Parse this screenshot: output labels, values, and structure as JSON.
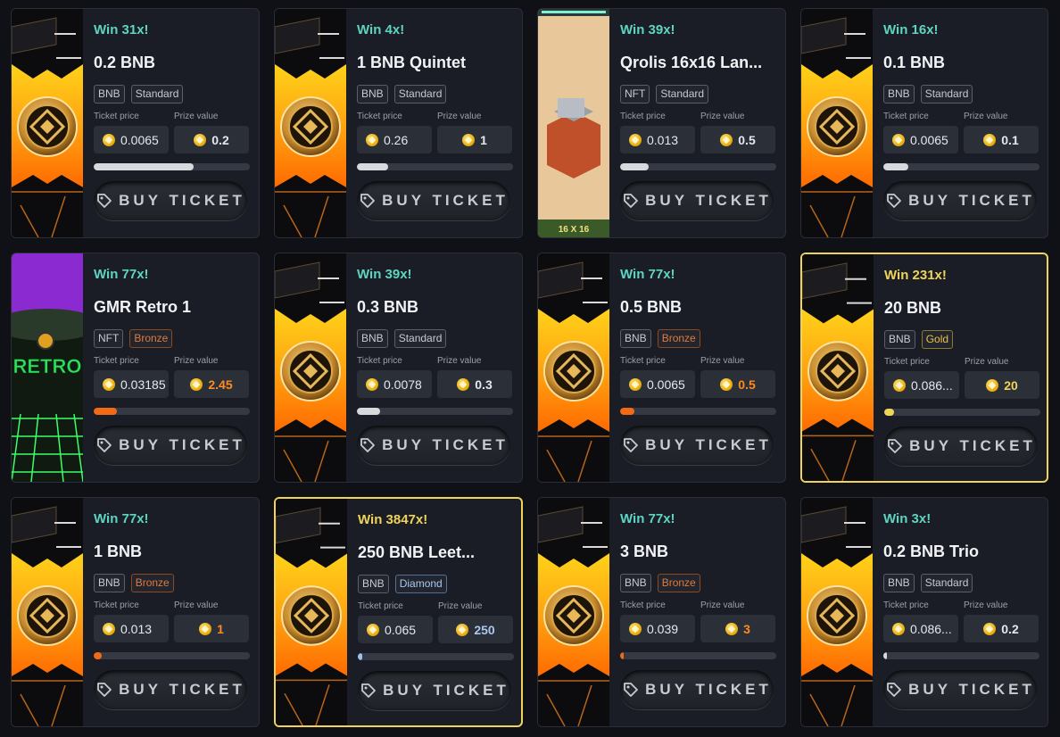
{
  "labels": {
    "ticket_price": "Ticket price",
    "prize_value": "Prize value",
    "buy": "BUY TICKET"
  },
  "cards": [
    {
      "win": "Win 31x!",
      "title": "0.2 BNB",
      "tag1": "BNB",
      "tag2": "Standard",
      "tier": "standard",
      "price": "0.0065",
      "prize": "0.2",
      "progress": 0.64,
      "thumb": "bnb"
    },
    {
      "win": "Win 4x!",
      "title": "1 BNB Quintet",
      "tag1": "BNB",
      "tag2": "Standard",
      "tier": "standard",
      "price": "0.26",
      "prize": "1",
      "progress": 0.2,
      "thumb": "bnb"
    },
    {
      "win": "Win 39x!",
      "title": "Qrolis 16x16 Lan...",
      "tag1": "NFT",
      "tag2": "Standard",
      "tier": "standard",
      "price": "0.013",
      "prize": "0.5",
      "progress": 0.18,
      "thumb": "qrolis",
      "thumb_label": "16 X 16"
    },
    {
      "win": "Win 16x!",
      "title": "0.1 BNB",
      "tag1": "BNB",
      "tag2": "Standard",
      "tier": "standard",
      "price": "0.0065",
      "prize": "0.1",
      "progress": 0.16,
      "thumb": "bnb"
    },
    {
      "win": "Win 77x!",
      "title": "GMR Retro 1",
      "tag1": "NFT",
      "tag2": "Bronze",
      "tier": "bronze",
      "price": "0.03185",
      "prize": "2.45",
      "progress": 0.15,
      "thumb": "retro",
      "thumb_label": "RETRO"
    },
    {
      "win": "Win 39x!",
      "title": "0.3 BNB",
      "tag1": "BNB",
      "tag2": "Standard",
      "tier": "standard",
      "price": "0.0078",
      "prize": "0.3",
      "progress": 0.15,
      "thumb": "bnb"
    },
    {
      "win": "Win 77x!",
      "title": "0.5 BNB",
      "tag1": "BNB",
      "tag2": "Bronze",
      "tier": "bronze",
      "price": "0.0065",
      "prize": "0.5",
      "progress": 0.09,
      "thumb": "bnb"
    },
    {
      "win": "Win 231x!",
      "title": "20 BNB",
      "tag1": "BNB",
      "tag2": "Gold",
      "tier": "gold",
      "price": "0.086...",
      "prize": "20",
      "progress": 0.06,
      "thumb": "bnb"
    },
    {
      "win": "Win 77x!",
      "title": "1 BNB",
      "tag1": "BNB",
      "tag2": "Bronze",
      "tier": "bronze",
      "price": "0.013",
      "prize": "1",
      "progress": 0.05,
      "thumb": "bnb"
    },
    {
      "win": "Win 3847x!",
      "title": "250 BNB Leet...",
      "tag1": "BNB",
      "tag2": "Diamond",
      "tier": "diamond",
      "price": "0.065",
      "prize": "250",
      "progress": 0.03,
      "thumb": "bnb"
    },
    {
      "win": "Win 77x!",
      "title": "3 BNB",
      "tag1": "BNB",
      "tag2": "Bronze",
      "tier": "bronze",
      "price": "0.039",
      "prize": "3",
      "progress": 0.01,
      "thumb": "bnb"
    },
    {
      "win": "Win 3x!",
      "title": "0.2 BNB Trio",
      "tag1": "BNB",
      "tag2": "Standard",
      "tier": "standard",
      "price": "0.086...",
      "prize": "0.2",
      "progress": 0.02,
      "thumb": "bnb"
    }
  ],
  "colors": {
    "accent_teal": "#5fd4c2",
    "gold": "#f0d35a",
    "bronze": "#f26a15",
    "diamond": "#9ec0ee"
  }
}
